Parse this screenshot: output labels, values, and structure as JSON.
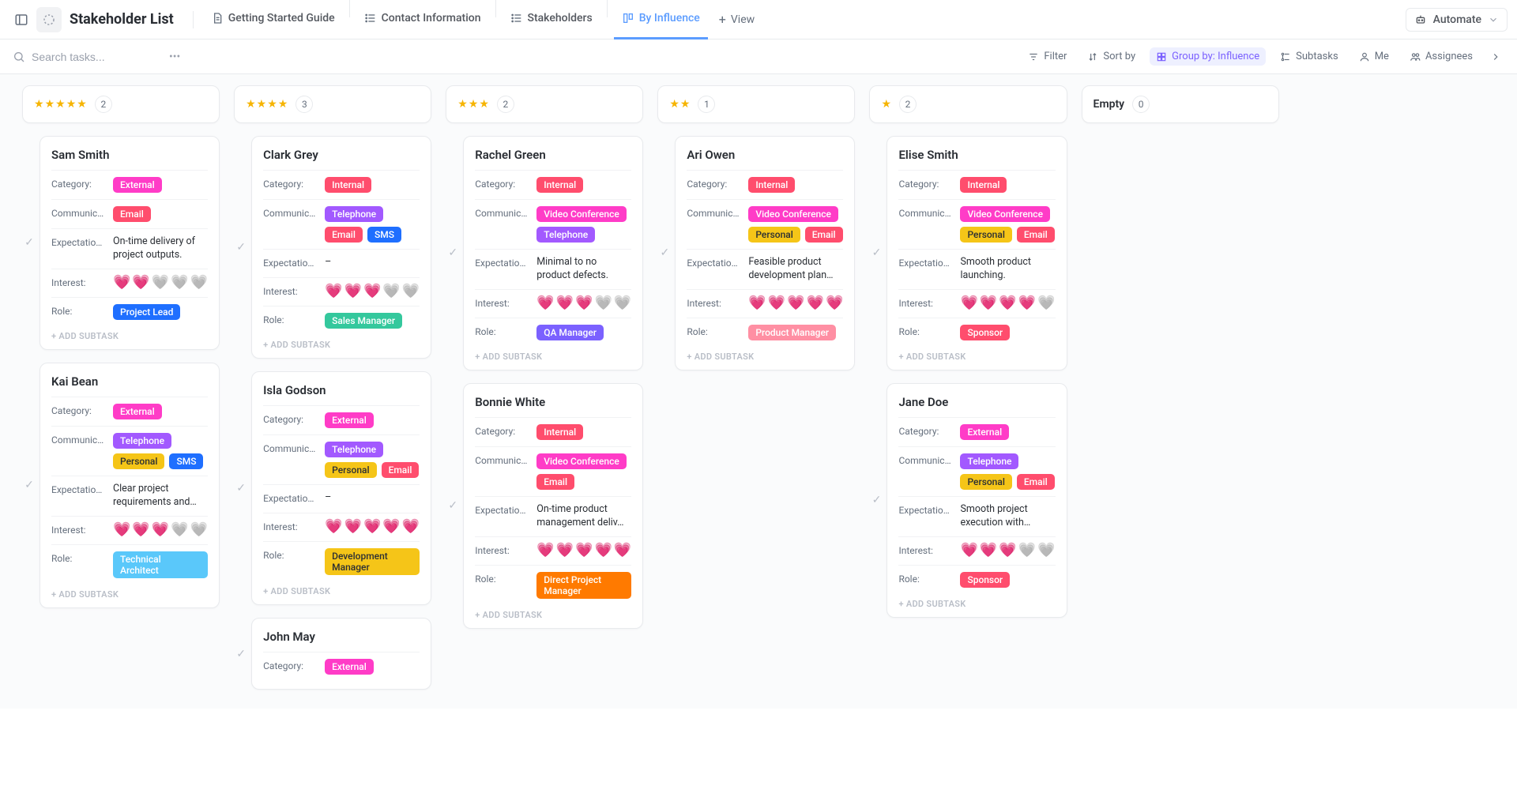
{
  "colors": {
    "External": "#ff3cc7",
    "Internal": "#ff4d6d",
    "Telephone": "#a259ff",
    "Email": "#ff4d6d",
    "SMS": "#1f6fff",
    "Video Conference": "#ff3cc7",
    "Personal": "#f5c518"
  },
  "roleColors": {
    "Project Lead": "#1f6fff",
    "Technical Architect": "#5ac8fa",
    "Sales Manager": "#34c89d",
    "Development Manager": "#f5c518",
    "QA Manager": "#7b61ff",
    "Direct Project Manager": "#ff7a00",
    "Product Manager": "#ff8fa3",
    "Sponsor": "#ff4d6d"
  },
  "header": {
    "title": "Stakeholder List",
    "tabs": [
      {
        "label": "Getting Started Guide",
        "icon": "doc"
      },
      {
        "label": "Contact Information",
        "icon": "list"
      },
      {
        "label": "Stakeholders",
        "icon": "list"
      },
      {
        "label": "By Influence",
        "icon": "board",
        "active": true
      }
    ],
    "addViewLabel": "View",
    "automateLabel": "Automate"
  },
  "toolbar": {
    "searchPlaceholder": "Search tasks...",
    "buttons": {
      "filter": "Filter",
      "sort": "Sort by",
      "group": "Group by: Influence",
      "subtasks": "Subtasks",
      "me": "Me",
      "assignees": "Assignees"
    }
  },
  "fieldLabels": {
    "category": "Category:",
    "communication": "Communic…",
    "expectation": "Expectatio…",
    "interest": "Interest:",
    "role": "Role:"
  },
  "addSubtaskLabel": "+ ADD SUBTASK",
  "columns": [
    {
      "stars": 5,
      "count": 2,
      "cards": [
        {
          "name": "Sam Smith",
          "category": "External",
          "communication": [
            "Email"
          ],
          "expectation": "On-time delivery of project outputs.",
          "interest": 2,
          "role": "Project Lead"
        },
        {
          "name": "Kai Bean",
          "category": "External",
          "communication": [
            "Telephone",
            "Personal",
            "SMS"
          ],
          "expectation": "Clear project requirements and fea…",
          "interest": 3,
          "role": "Technical Architect"
        }
      ]
    },
    {
      "stars": 4,
      "count": 3,
      "cards": [
        {
          "name": "Clark Grey",
          "category": "Internal",
          "communication": [
            "Telephone",
            "Email",
            "SMS"
          ],
          "expectation": "–",
          "interest": 3,
          "role": "Sales Manager"
        },
        {
          "name": "Isla Godson",
          "category": "External",
          "communication": [
            "Telephone",
            "Personal",
            "Email"
          ],
          "expectation": "–",
          "interest": 5,
          "role": "Development Manager"
        },
        {
          "name": "John May",
          "category": "External",
          "communication": [],
          "expectation": "",
          "interest": null,
          "role": "",
          "partial": true
        }
      ]
    },
    {
      "stars": 3,
      "count": 2,
      "cards": [
        {
          "name": "Rachel Green",
          "category": "Internal",
          "communication": [
            "Video Conference",
            "Telephone"
          ],
          "expectation": "Minimal to no product defects.",
          "interest": 3,
          "role": "QA Manager"
        },
        {
          "name": "Bonnie White",
          "category": "Internal",
          "communication": [
            "Video Conference",
            "Email"
          ],
          "expectation": "On-time product management deliv…",
          "interest": 5,
          "role": "Direct Project Manager"
        }
      ]
    },
    {
      "stars": 2,
      "count": 1,
      "cards": [
        {
          "name": "Ari Owen",
          "category": "Internal",
          "communication": [
            "Video Conference",
            "Personal",
            "Email"
          ],
          "expectation": "Feasible product development plan and…",
          "interest": 5,
          "role": "Product Manager"
        }
      ]
    },
    {
      "stars": 1,
      "count": 2,
      "cards": [
        {
          "name": "Elise Smith",
          "category": "Internal",
          "communication": [
            "Video Conference",
            "Personal",
            "Email"
          ],
          "expectation": "Smooth product launching.",
          "interest": 4,
          "role": "Sponsor"
        },
        {
          "name": "Jane Doe",
          "category": "External",
          "communication": [
            "Telephone",
            "Personal",
            "Email"
          ],
          "expectation": "Smooth project execution with minimal…",
          "interest": 3,
          "role": "Sponsor"
        }
      ]
    },
    {
      "empty": true,
      "emptyLabel": "Empty",
      "count": 0,
      "cards": []
    }
  ]
}
